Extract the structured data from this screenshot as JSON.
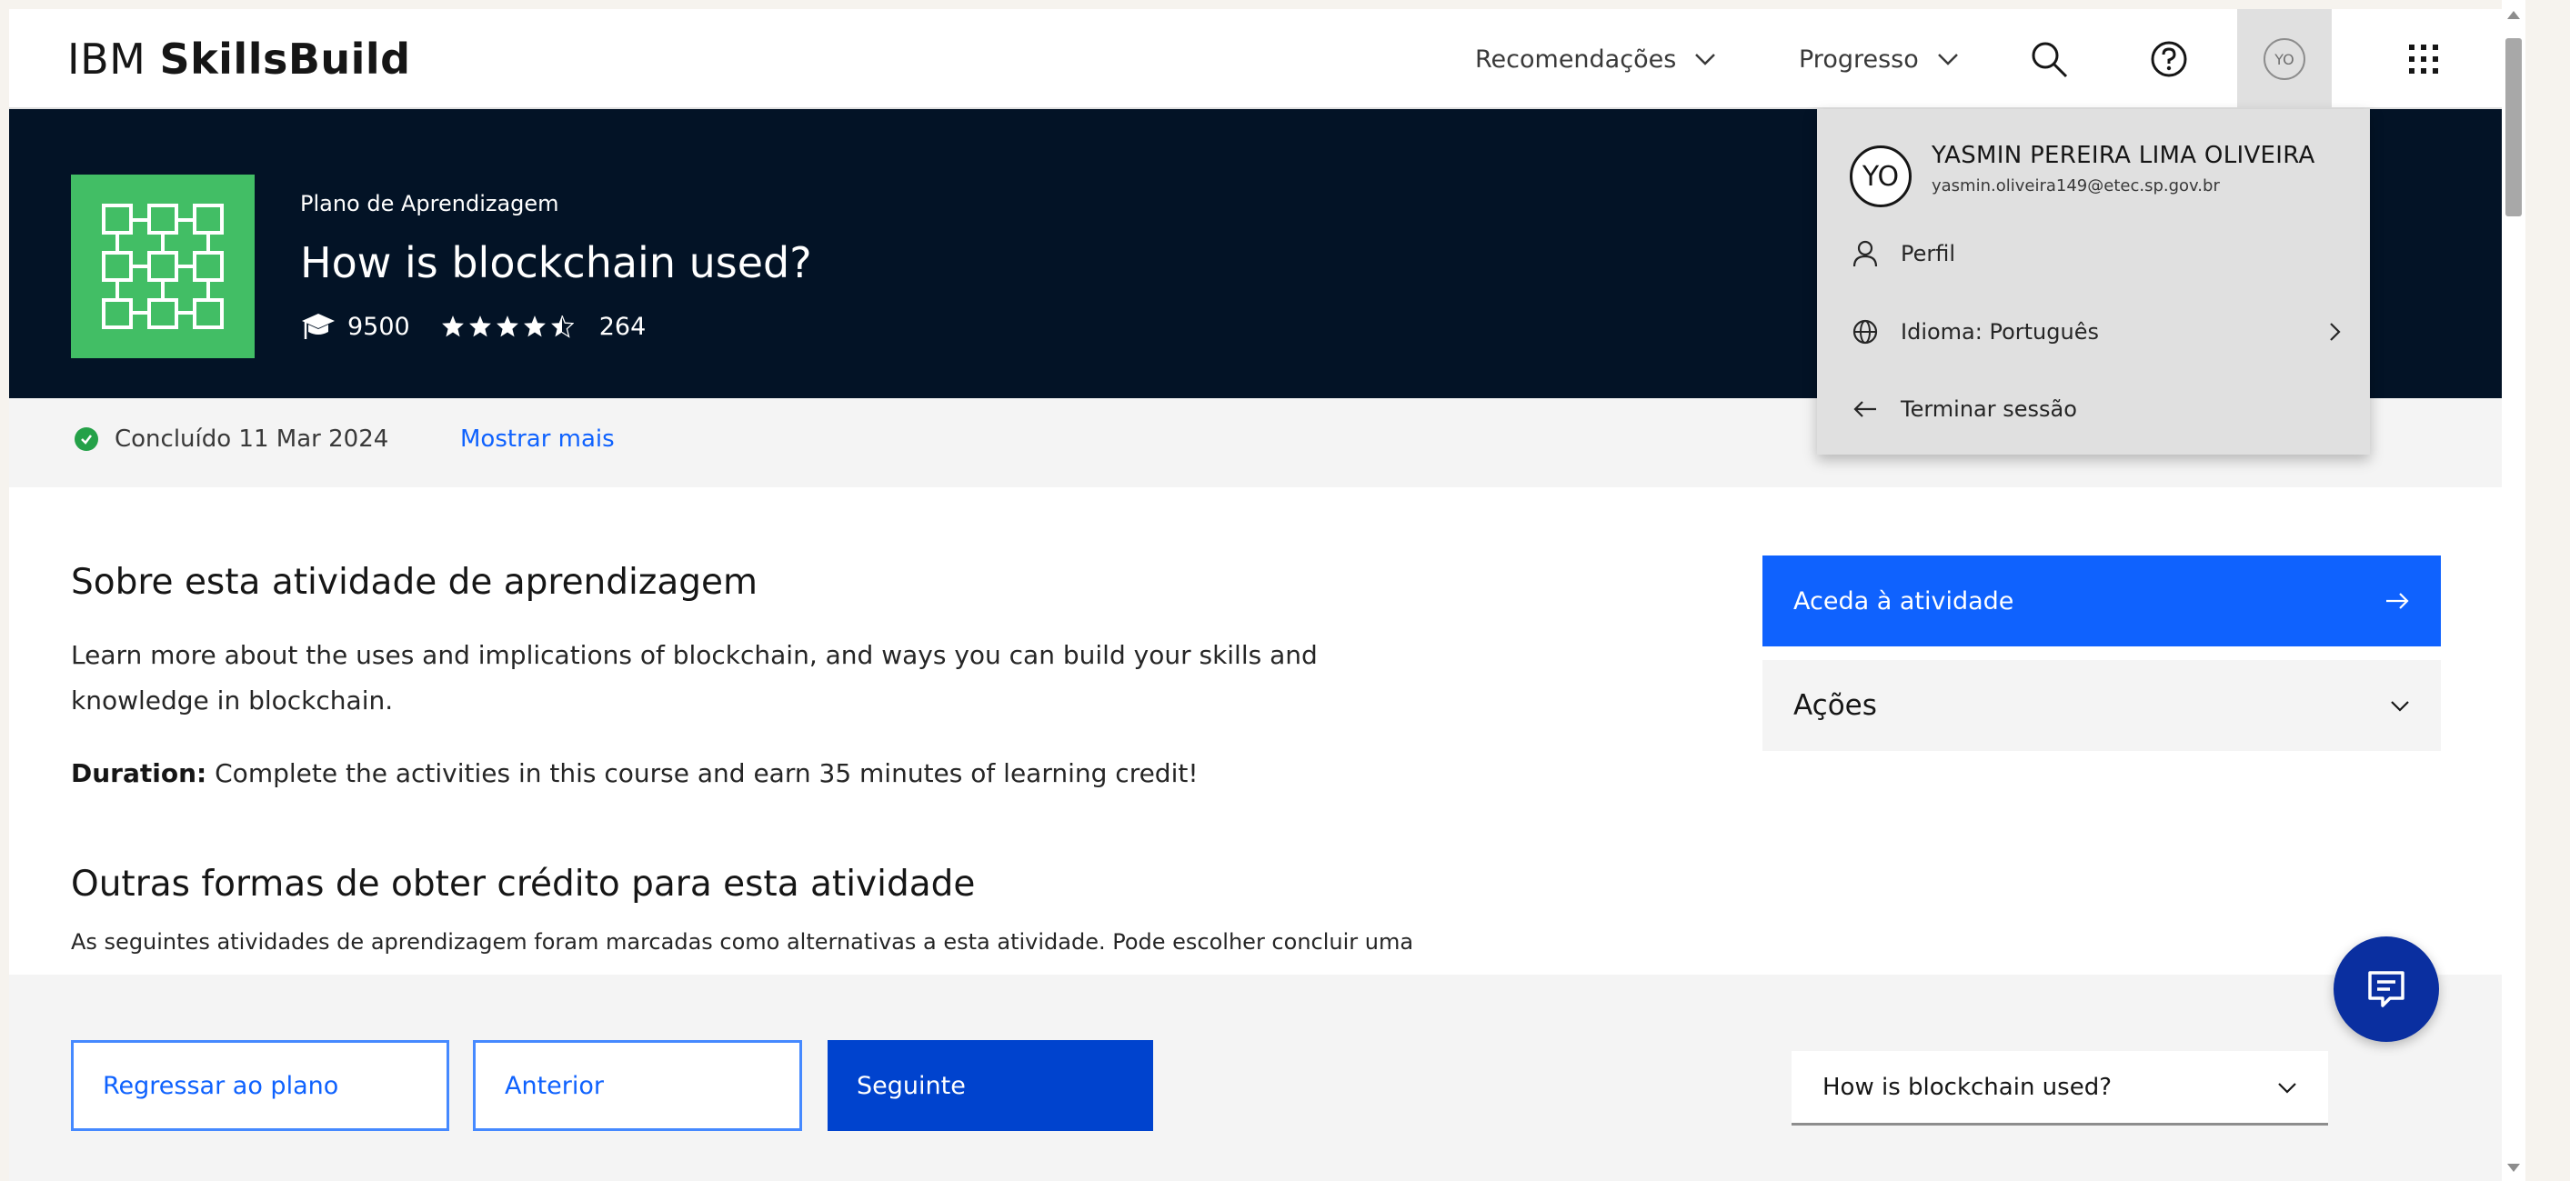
{
  "header": {
    "brand_light": "IBM",
    "brand_bold": "SkillsBuild",
    "nav_recommendations": "Recomendações",
    "nav_progress": "Progresso"
  },
  "hero": {
    "eyebrow": "Plano de Aprendizagem",
    "title": "How is blockchain used?",
    "learners": "9500",
    "rating": 4.5,
    "reviews": "264"
  },
  "status": {
    "completed": "Concluído 11 Mar 2024",
    "show_more": "Mostrar mais"
  },
  "content": {
    "about_title": "Sobre esta atividade de aprendizagem",
    "description": "Learn more about the uses and implications of blockchain, and ways you can build your skills and knowledge in blockchain.",
    "duration_label": "Duration:",
    "duration_text": " Complete the activities in this course and earn 35 minutes of learning credit!",
    "other_title": "Outras formas de obter crédito para esta atividade",
    "other_text": "As seguintes atividades de aprendizagem foram marcadas como alternativas a esta atividade. Pode escolher concluir uma",
    "access_button": "Aceda à atividade",
    "actions_label": "Ações"
  },
  "bottom": {
    "back_to_plan": "Regressar ao plano",
    "previous": "Anterior",
    "next": "Seguinte",
    "course_select": "How is blockchain used?"
  },
  "user_menu": {
    "initials": "YO",
    "name": "YASMIN PEREIRA LIMA OLIVEIRA",
    "email": "yasmin.oliveira149@etec.sp.gov.br",
    "profile": "Perfil",
    "language": "Idioma: Português",
    "logout": "Terminar sessão"
  },
  "colors": {
    "primary_blue": "#0f62fe",
    "dark_blue": "#0043ce",
    "hero_bg": "#031326",
    "tile_green": "#42be65",
    "success_green": "#24a148"
  }
}
